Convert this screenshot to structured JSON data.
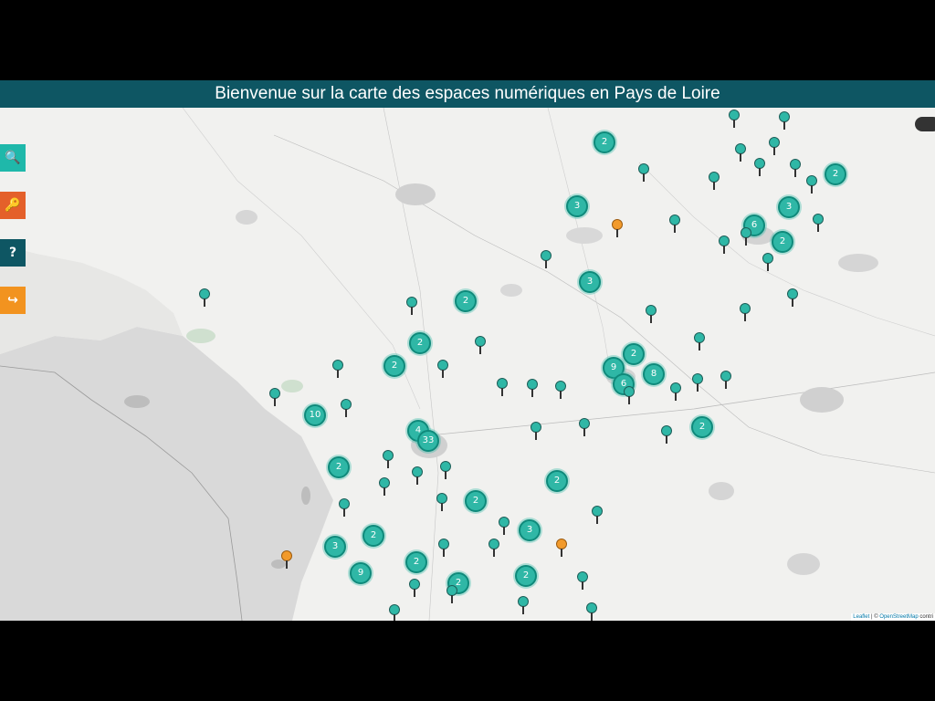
{
  "header": {
    "title": "Bienvenue sur la carte des espaces numériques en Pays de Loire"
  },
  "sidebar": {
    "buttons": [
      {
        "name": "search-button",
        "icon": "search-icon",
        "glyph": "🔍",
        "color": "#1fb8aa"
      },
      {
        "name": "filter-button",
        "icon": "key-icon",
        "glyph": "🔑",
        "color": "#e4602a"
      },
      {
        "name": "help-button",
        "icon": "help-icon",
        "glyph": "?",
        "color": "#0e5663"
      },
      {
        "name": "share-button",
        "icon": "share-icon",
        "glyph": "↪",
        "color": "#f2931f"
      }
    ]
  },
  "map": {
    "clusters": [
      {
        "count": "2"
      },
      {
        "count": "3"
      },
      {
        "count": "6"
      },
      {
        "count": "3"
      },
      {
        "count": "2"
      },
      {
        "count": "2"
      },
      {
        "count": "3"
      },
      {
        "count": "2"
      },
      {
        "count": "2"
      },
      {
        "count": "2"
      },
      {
        "count": "2"
      },
      {
        "count": "9"
      },
      {
        "count": "8"
      },
      {
        "count": "6"
      },
      {
        "count": "10"
      },
      {
        "count": "4"
      },
      {
        "count": "33"
      },
      {
        "count": "2"
      },
      {
        "count": "2"
      },
      {
        "count": "2"
      },
      {
        "count": "2"
      },
      {
        "count": "2"
      },
      {
        "count": "3"
      },
      {
        "count": "2"
      },
      {
        "count": "3"
      },
      {
        "count": "9"
      },
      {
        "count": "2"
      },
      {
        "count": "2"
      }
    ],
    "pin_count_teal": 52,
    "pin_count_orange": 3
  },
  "attribution": {
    "leaflet": "Leaflet",
    "sep": " | © ",
    "osm": "OpenStreetMap",
    "suffix": " contri"
  },
  "colors": {
    "banner": "#0e5663",
    "marker": "#2fb7a6",
    "orange_marker": "#f29a2b"
  }
}
